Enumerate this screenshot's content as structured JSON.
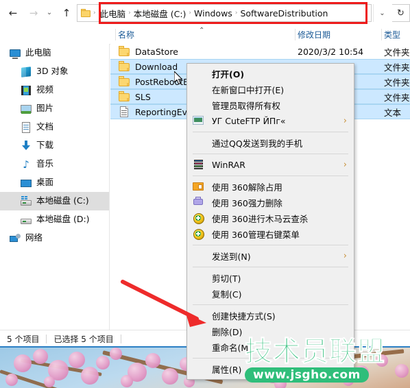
{
  "window": {
    "title": "SoftwareDistribution"
  },
  "nav": {
    "back": "←",
    "forward": "→",
    "recent": "⌄",
    "up": "↑",
    "dropdown": "⌄",
    "refresh": "↻",
    "separator": "›"
  },
  "address": {
    "crumbs": [
      "此电脑",
      "本地磁盘 (C:)",
      "Windows",
      "SoftwareDistribution"
    ],
    "highlight_color": "#ee1b1b"
  },
  "columns": {
    "name": "名称",
    "date": "修改日期",
    "type": "类型",
    "sort_caret": "⌃"
  },
  "navpane": {
    "items": [
      {
        "label": "此电脑",
        "icon": "computer-icon",
        "level": 0,
        "selected": false
      },
      {
        "label": "3D 对象",
        "icon": "3d-objects-icon",
        "level": 1,
        "selected": false
      },
      {
        "label": "视频",
        "icon": "videos-icon",
        "level": 1,
        "selected": false
      },
      {
        "label": "图片",
        "icon": "pictures-icon",
        "level": 1,
        "selected": false
      },
      {
        "label": "文档",
        "icon": "documents-icon",
        "level": 1,
        "selected": false
      },
      {
        "label": "下载",
        "icon": "downloads-icon",
        "level": 1,
        "selected": false
      },
      {
        "label": "音乐",
        "icon": "music-icon",
        "level": 1,
        "selected": false
      },
      {
        "label": "桌面",
        "icon": "desktop-icon",
        "level": 1,
        "selected": false
      },
      {
        "label": "本地磁盘 (C:)",
        "icon": "drive-c-icon",
        "level": 1,
        "selected": true
      },
      {
        "label": "本地磁盘 (D:)",
        "icon": "drive-d-icon",
        "level": 1,
        "selected": false
      },
      {
        "label": "网络",
        "icon": "network-icon",
        "level": 0,
        "selected": false
      }
    ]
  },
  "files": {
    "rows": [
      {
        "name": "DataStore",
        "date": "2020/3/2 10:54",
        "type": "文件夹",
        "icon": "folder-icon",
        "selected": false
      },
      {
        "name": "Download",
        "date": "",
        "type": "文件夹",
        "icon": "folder-icon",
        "selected": true
      },
      {
        "name": "PostRebootEv",
        "date": "",
        "type": "文件夹",
        "icon": "folder-icon",
        "selected": true
      },
      {
        "name": "SLS",
        "date": "",
        "type": "文件夹",
        "icon": "folder-icon",
        "selected": true
      },
      {
        "name": "ReportingEve",
        "date": "",
        "type": "文本",
        "icon": "text-file-icon",
        "selected": true
      }
    ]
  },
  "contextmenu": {
    "items": [
      {
        "label": "打开(O)",
        "icon": null,
        "bold": true,
        "arrow": false,
        "sep_after": false
      },
      {
        "label": "在新窗口中打开(E)",
        "icon": null,
        "bold": false,
        "arrow": false,
        "sep_after": false
      },
      {
        "label": "管理员取得所有权",
        "icon": null,
        "bold": false,
        "arrow": false,
        "sep_after": false
      },
      {
        "label": "УГ CuteFTP ЙПг«",
        "icon": "cuteftp-icon",
        "bold": false,
        "arrow": true,
        "sep_after": true
      },
      {
        "label": "通过QQ发送到我的手机",
        "icon": null,
        "bold": false,
        "arrow": false,
        "sep_after": true
      },
      {
        "label": "WinRAR",
        "icon": "winrar-icon",
        "bold": false,
        "arrow": true,
        "sep_after": true
      },
      {
        "label": "使用 360解除占用",
        "icon": "360-unlock-icon",
        "bold": false,
        "arrow": false,
        "sep_after": false
      },
      {
        "label": "使用 360强力删除",
        "icon": "360-forcedelete-icon",
        "bold": false,
        "arrow": false,
        "sep_after": false
      },
      {
        "label": "使用 360进行木马云查杀",
        "icon": "360-scan-icon",
        "bold": false,
        "arrow": false,
        "sep_after": false
      },
      {
        "label": "使用 360管理右键菜单",
        "icon": "360-manage-icon",
        "bold": false,
        "arrow": false,
        "sep_after": true
      },
      {
        "label": "发送到(N)",
        "icon": null,
        "bold": false,
        "arrow": true,
        "sep_after": true
      },
      {
        "label": "剪切(T)",
        "icon": null,
        "bold": false,
        "arrow": false,
        "sep_after": false
      },
      {
        "label": "复制(C)",
        "icon": null,
        "bold": false,
        "arrow": false,
        "sep_after": true
      },
      {
        "label": "创建快捷方式(S)",
        "icon": null,
        "bold": false,
        "arrow": false,
        "sep_after": false
      },
      {
        "label": "删除(D)",
        "icon": null,
        "bold": false,
        "arrow": false,
        "sep_after": false
      },
      {
        "label": "重命名(M)",
        "icon": null,
        "bold": false,
        "arrow": false,
        "sep_after": true
      },
      {
        "label": "属性(R)",
        "icon": null,
        "bold": false,
        "arrow": false,
        "sep_after": false
      }
    ],
    "submenu_arrow": "›"
  },
  "statusbar": {
    "count": "5 个项目",
    "selected": "已选择 5 个项目"
  },
  "annotation": {
    "arrow_color": "#ee2b2b",
    "points_at": "删除(D)"
  },
  "watermark": {
    "title": "技术员联盟",
    "url": "www.jsgho.com",
    "color": "#2fbe7a"
  }
}
